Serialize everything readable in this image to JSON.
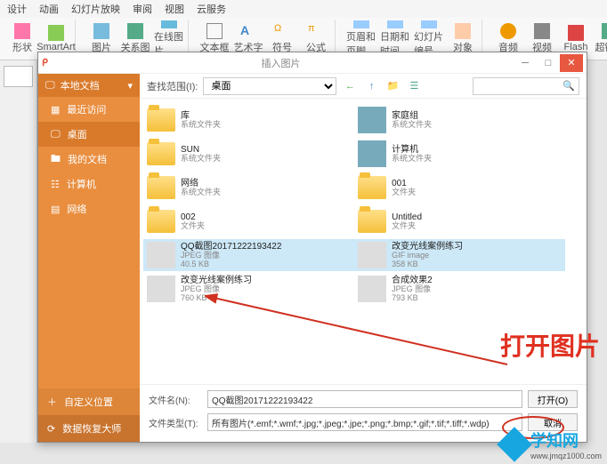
{
  "menu": {
    "items": [
      "设计",
      "动画",
      "幻灯片放映",
      "审阅",
      "视图",
      "云服务"
    ]
  },
  "ribbon": {
    "groups": [
      {
        "items": [
          {
            "label": "形状"
          },
          {
            "label": "SmartArt"
          }
        ]
      },
      {
        "items": [
          {
            "label": "图片"
          },
          {
            "label": "关系图"
          },
          {
            "label": "在线图片"
          }
        ]
      },
      {
        "items": [
          {
            "label": "文本框"
          },
          {
            "label": "艺术字"
          },
          {
            "label": "符号"
          },
          {
            "label": "公式"
          }
        ]
      },
      {
        "items": [
          {
            "label": "页眉和页脚"
          },
          {
            "label": "日期和时间"
          },
          {
            "label": "幻灯片编号"
          },
          {
            "label": "对象"
          }
        ]
      },
      {
        "items": [
          {
            "label": "音频"
          },
          {
            "label": "视频"
          },
          {
            "label": "Flash"
          },
          {
            "label": "超链接"
          }
        ]
      }
    ]
  },
  "dialog": {
    "title": "插入图片",
    "sidebar": {
      "head": "本地文档",
      "items": [
        {
          "label": "最近访问",
          "icon": "clock-icon"
        },
        {
          "label": "桌面",
          "icon": "desktop-icon",
          "active": true
        },
        {
          "label": "我的文档",
          "icon": "folder-icon"
        },
        {
          "label": "计算机",
          "icon": "computer-icon"
        },
        {
          "label": "网络",
          "icon": "network-icon"
        }
      ],
      "footer": {
        "custom": "自定义位置",
        "recover": "数据恢复大师"
      }
    },
    "toolbar": {
      "scope_label": "查找范围(I):",
      "scope_value": "桌面",
      "search_placeholder": ""
    },
    "files": [
      {
        "name": "库",
        "sub": "系统文件夹",
        "type": "folder"
      },
      {
        "name": "家庭组",
        "sub": "系统文件夹",
        "type": "sys"
      },
      {
        "name": "SUN",
        "sub": "系统文件夹",
        "type": "folder"
      },
      {
        "name": "计算机",
        "sub": "系统文件夹",
        "type": "sys"
      },
      {
        "name": "网络",
        "sub": "系统文件夹",
        "type": "folder"
      },
      {
        "name": "001",
        "sub": "文件夹",
        "type": "folder"
      },
      {
        "name": "002",
        "sub": "文件夹",
        "type": "folder"
      },
      {
        "name": "Untitled",
        "sub": "文件夹",
        "type": "folder"
      },
      {
        "name": "QQ截图20171222193422",
        "sub": "JPEG 图像",
        "size": "40.5 KB",
        "type": "image",
        "selected": true
      },
      {
        "name": "改变光线案例练习",
        "sub": "GIF image",
        "size": "358 KB",
        "type": "image",
        "selected": true
      },
      {
        "name": "改变光线案例练习",
        "sub": "JPEG 图像",
        "size": "760 KB",
        "type": "image"
      },
      {
        "name": "合成效果2",
        "sub": "JPEG 图像",
        "size": "793 KB",
        "type": "image"
      }
    ],
    "bottom": {
      "filename_label": "文件名(N):",
      "filename_value": "QQ截图20171222193422",
      "filetype_label": "文件类型(T):",
      "filetype_value": "所有图片(*.emf;*.wmf;*.jpg;*.jpeg;*.jpe;*.png;*.bmp;*.gif;*.tif;*.tiff;*.wdp)",
      "open_btn": "打开(O)",
      "cancel_btn": "取消"
    }
  },
  "annotation": {
    "text": "打开图片"
  },
  "watermark": {
    "text": "学知网",
    "url": "www.jmqz1000.com"
  }
}
